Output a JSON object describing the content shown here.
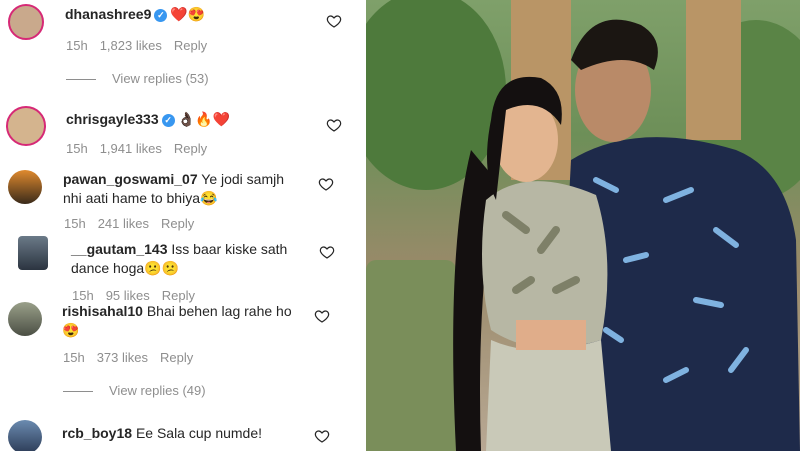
{
  "comments": [
    {
      "username": "dhanashree9",
      "verified": true,
      "text": "",
      "emoji": "❤️😍",
      "time": "15h",
      "likes": "1,823 likes",
      "reply": "Reply"
    },
    {
      "username": "chrisgayle333",
      "verified": true,
      "text": "",
      "emoji": "👌🏿🔥❤️",
      "time": "15h",
      "likes": "1,941 likes",
      "reply": "Reply"
    },
    {
      "username": "pawan_goswami_07",
      "verified": false,
      "text": "Ye jodi samjh nhi aati hame to bhiya",
      "emoji": "😂",
      "time": "15h",
      "likes": "241 likes",
      "reply": "Reply"
    },
    {
      "username": "__gautam_143",
      "verified": false,
      "text": "Iss baar kiske sath dance hoga",
      "emoji": "😕😕",
      "time": "15h",
      "likes": "95 likes",
      "reply": "Reply"
    },
    {
      "username": "rishisahal10",
      "verified": false,
      "text": "Bhai behen lag rahe ho",
      "emoji": "😍",
      "time": "15h",
      "likes": "373 likes",
      "reply": "Reply"
    },
    {
      "username": "rcb_boy18",
      "verified": false,
      "text": "Ee Sala cup numde!",
      "emoji": "",
      "time": "",
      "likes": "",
      "reply": ""
    }
  ],
  "view_replies": [
    "View replies (53)",
    "View replies (49)"
  ],
  "icons": {
    "like": "heart-outline-icon",
    "verified": "verified-badge-icon"
  },
  "colors": {
    "verified": "#3897f0",
    "meta": "#8e8e8e",
    "story_ring": "#d62976"
  }
}
